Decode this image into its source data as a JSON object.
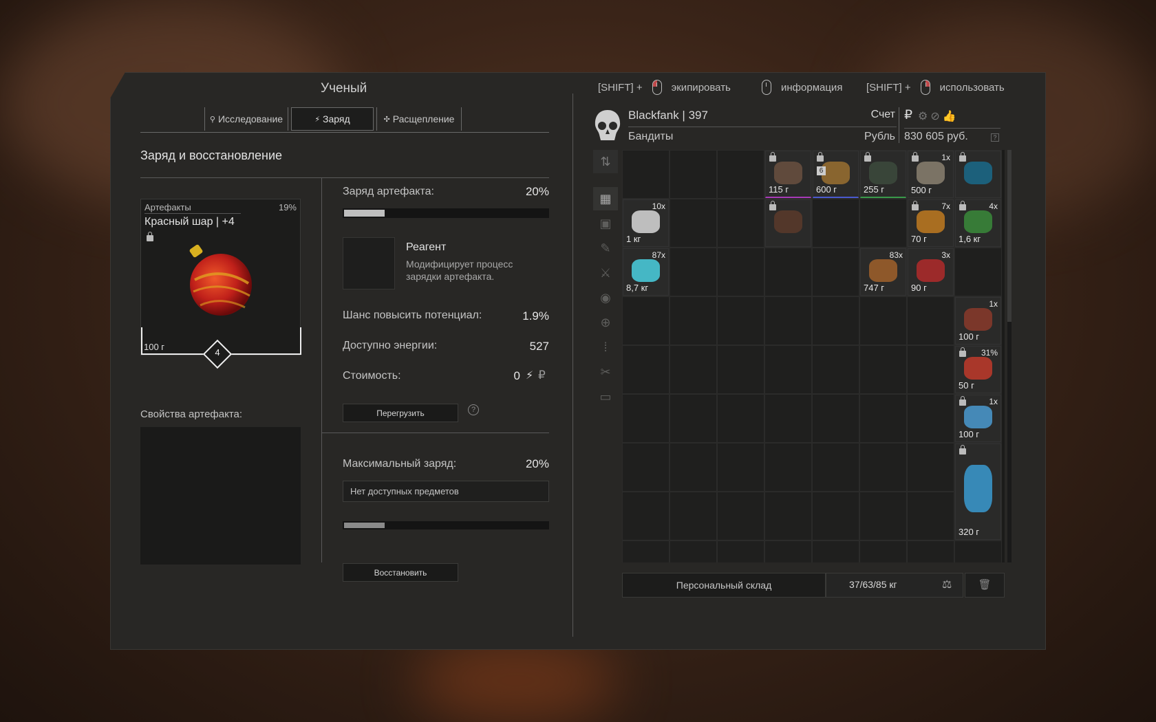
{
  "window": {
    "title": "Ученый"
  },
  "hints": [
    {
      "prefix": "[SHIFT] +",
      "action": "экипировать"
    },
    {
      "prefix": "",
      "action": "информация"
    },
    {
      "prefix": "[SHIFT] +",
      "action": "использовать"
    }
  ],
  "tabs": [
    {
      "label": "Исследование",
      "icon": "search-icon"
    },
    {
      "label": "Заряд",
      "icon": "lightning-icon",
      "active": true
    },
    {
      "label": "Расщепление",
      "icon": "split-icon"
    }
  ],
  "section_title": "Заряд и восстановление",
  "artifact": {
    "category": "Артефакты",
    "percent": "19%",
    "name": "Красный шар | +4",
    "weight": "100 г",
    "level": "4"
  },
  "charge": {
    "label": "Заряд артефакта:",
    "value": "20%",
    "fill": 0.2
  },
  "reagent": {
    "title": "Реагент",
    "description": "Модифицирует процесс зарядки артефакта."
  },
  "stats": [
    {
      "label": "Шанс повысить потенциал:",
      "value": "1.9%"
    },
    {
      "label": "Доступно энергии:",
      "value": "527"
    },
    {
      "label": "Стоимость:",
      "value": "0"
    }
  ],
  "overload_button": "Перегрузить",
  "help_icon": "?",
  "artifact_props_label": "Свойства артефакта:",
  "max_charge": {
    "label": "Максимальный заряд:",
    "value": "20%",
    "dropdown": "Нет доступных предметов",
    "fill": 0.2
  },
  "restore_button": "Восстановить",
  "player": {
    "name": "Blackfank | 397",
    "faction": "Бандиты",
    "account_label": "Счет",
    "currency_label": "Рубль",
    "balance": "830 605 руб.",
    "ruble_symbol": "₽",
    "help": "?"
  },
  "inventory": {
    "items": [
      {
        "weight": "115 г",
        "qty": "",
        "locked": true,
        "color": "#6a5040",
        "accent": "#a83ab8"
      },
      {
        "weight": "600 г",
        "qty": "",
        "locked": true,
        "color": "#9a7030",
        "accent": "#4a5ad0",
        "badge": "6"
      },
      {
        "weight": "255 г",
        "qty": "",
        "locked": true,
        "color": "#3c4a3c",
        "accent": "#3a9a4a"
      },
      {
        "weight": "500 г",
        "qty": "1x",
        "locked": true,
        "color": "#8a8070",
        "accent": ""
      },
      {
        "weight": "",
        "qty": "",
        "locked": true,
        "color": "#1a6a8a",
        "accent": ""
      },
      {
        "weight": "1 кг",
        "qty": "10x",
        "locked": false,
        "color": "#d8d8d8",
        "accent": ""
      },
      {
        "weight": "",
        "qty": "",
        "locked": true,
        "color": "#5a3a2a",
        "accent": ""
      },
      {
        "weight": "70 г",
        "qty": "7x",
        "locked": true,
        "color": "#c07a20",
        "accent": ""
      },
      {
        "weight": "1,6 кг",
        "qty": "4x",
        "locked": true,
        "color": "#3a8a3a",
        "accent": ""
      },
      {
        "weight": "8,7 кг",
        "qty": "87x",
        "locked": false,
        "color": "#4ad0e0",
        "accent": ""
      },
      {
        "weight": "747 г",
        "qty": "83x",
        "locked": false,
        "color": "#a0602a",
        "accent": ""
      },
      {
        "weight": "90 г",
        "qty": "3x",
        "locked": false,
        "color": "#b02a2a",
        "accent": ""
      },
      {
        "weight": "100 г",
        "qty": "1x",
        "locked": false,
        "color": "#8a3a2a",
        "accent": ""
      },
      {
        "weight": "50 г",
        "qty": "31%",
        "locked": true,
        "color": "#c03a2a",
        "accent": ""
      },
      {
        "weight": "100 г",
        "qty": "1x",
        "locked": true,
        "color": "#4a9ad0",
        "accent": ""
      },
      {
        "weight": "320 г",
        "qty": "",
        "locked": true,
        "color": "#3a9ad0",
        "accent": ""
      }
    ]
  },
  "storage": {
    "label": "Персональный склад",
    "weight": "37/63/85 кг"
  }
}
